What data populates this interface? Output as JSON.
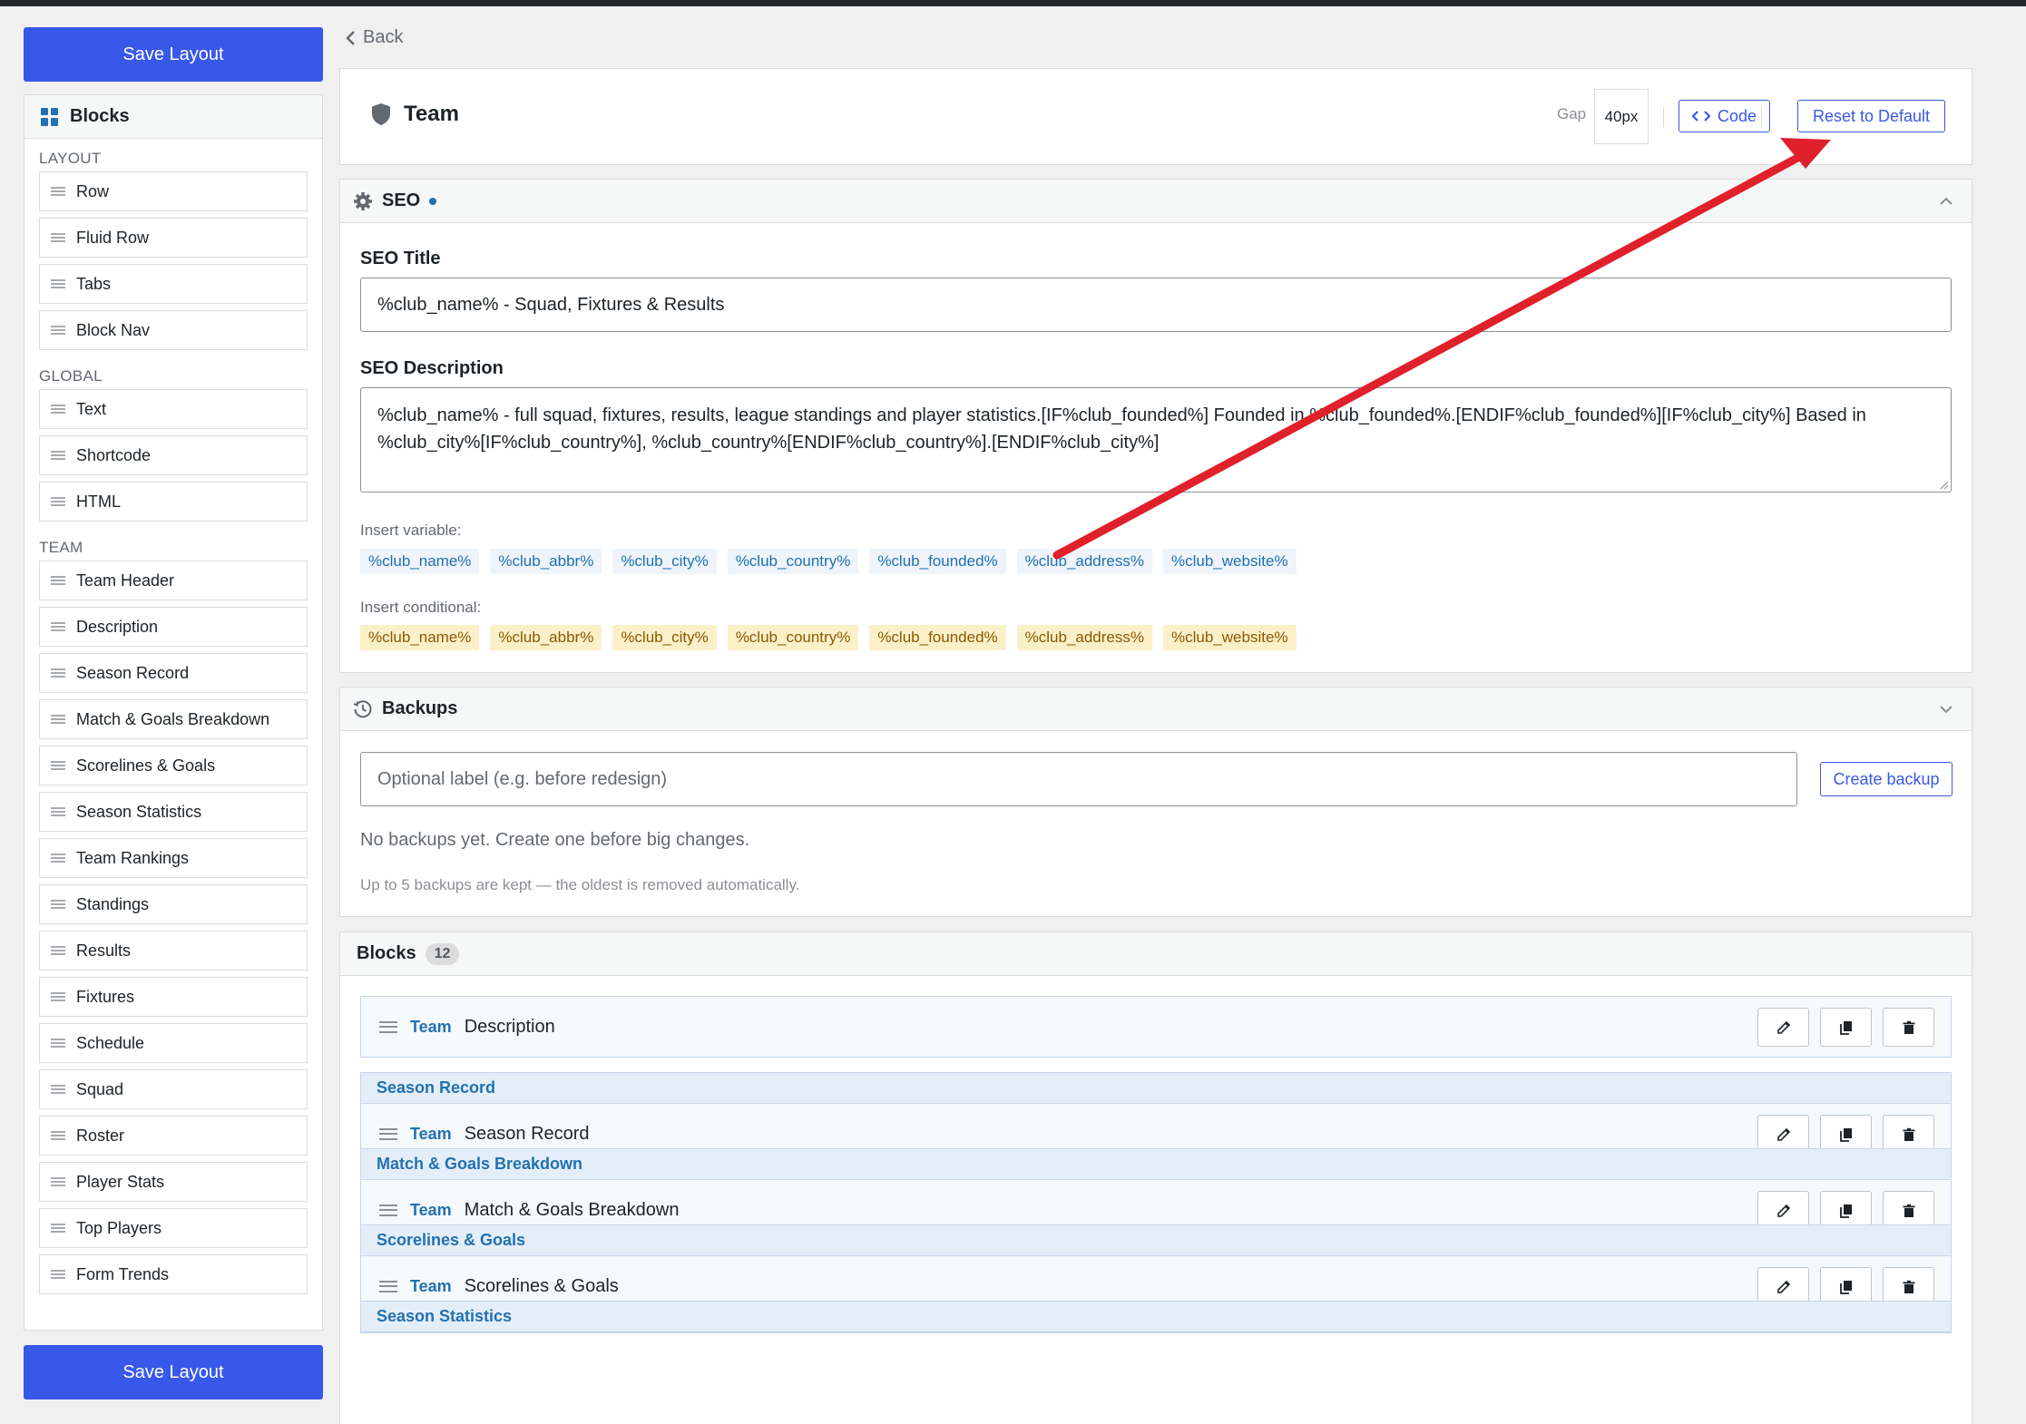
{
  "sidebar": {
    "save_label": "Save Layout",
    "panel_title": "Blocks",
    "groups": [
      {
        "label": "LAYOUT",
        "items": [
          "Row",
          "Fluid Row",
          "Tabs",
          "Block Nav"
        ]
      },
      {
        "label": "GLOBAL",
        "items": [
          "Text",
          "Shortcode",
          "HTML"
        ]
      },
      {
        "label": "TEAM",
        "items": [
          "Team Header",
          "Description",
          "Season Record",
          "Match & Goals Breakdown",
          "Scorelines & Goals",
          "Season Statistics",
          "Team Rankings",
          "Standings",
          "Results",
          "Fixtures",
          "Schedule",
          "Squad",
          "Roster",
          "Player Stats",
          "Top Players",
          "Form Trends"
        ]
      }
    ]
  },
  "nav": {
    "back_label": "Back"
  },
  "header": {
    "title": "Team",
    "gap_label": "Gap",
    "gap_value": "40px",
    "code_label": "Code",
    "reset_label": "Reset to Default"
  },
  "seo": {
    "section_title": "SEO",
    "title_label": "SEO Title",
    "title_value": "%club_name% - Squad, Fixtures & Results",
    "description_label": "SEO Description",
    "description_value": "%club_name% - full squad, fixtures, results, league standings and player statistics.[IF%club_founded%] Founded in %club_founded%.[ENDIF%club_founded%][IF%club_city%] Based in %club_city%[IF%club_country%], %club_country%[ENDIF%club_country%].[ENDIF%club_city%]",
    "insert_variable_label": "Insert variable:",
    "insert_conditional_label": "Insert conditional:",
    "variables": [
      "%club_name%",
      "%club_abbr%",
      "%club_city%",
      "%club_country%",
      "%club_founded%",
      "%club_address%",
      "%club_website%"
    ]
  },
  "backups": {
    "section_title": "Backups",
    "input_placeholder": "Optional label (e.g. before redesign)",
    "create_label": "Create backup",
    "empty_text": "No backups yet. Create one before big changes.",
    "note": "Up to 5 backups are kept — the oldest is removed automatically."
  },
  "block_list": {
    "title": "Blocks",
    "count": "12",
    "rows": [
      {
        "group": "",
        "type": "Team",
        "name": "Description"
      },
      {
        "group": "Season Record",
        "type": "Team",
        "name": "Season Record"
      },
      {
        "group": "Match & Goals Breakdown",
        "type": "Team",
        "name": "Match & Goals Breakdown"
      },
      {
        "group": "Scorelines & Goals",
        "type": "Team",
        "name": "Scorelines & Goals"
      },
      {
        "group": "Season Statistics",
        "type": "",
        "name": ""
      }
    ]
  },
  "colors": {
    "primary": "#3858e9",
    "accent": "#2271b1",
    "annotation_arrow": "#e0202a"
  }
}
